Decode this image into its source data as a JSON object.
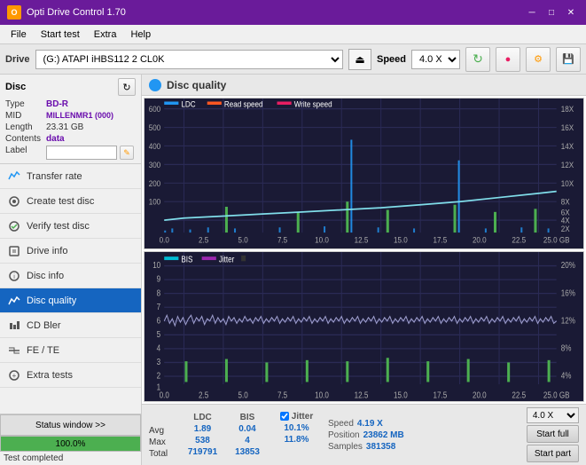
{
  "titlebar": {
    "title": "Opti Drive Control 1.70",
    "min_btn": "─",
    "max_btn": "□",
    "close_btn": "✕"
  },
  "menubar": {
    "items": [
      "File",
      "Start test",
      "Extra",
      "Help"
    ]
  },
  "drivebar": {
    "drive_label": "Drive",
    "drive_value": "(G:) ATAPI iHBS112  2 CL0K",
    "speed_label": "Speed",
    "speed_value": "4.0 X"
  },
  "disc_panel": {
    "title": "Disc",
    "type_label": "Type",
    "type_value": "BD-R",
    "mid_label": "MID",
    "mid_value": "MILLENMR1 (000)",
    "length_label": "Length",
    "length_value": "23.31 GB",
    "contents_label": "Contents",
    "contents_value": "data",
    "label_label": "Label"
  },
  "nav_items": [
    {
      "id": "transfer-rate",
      "label": "Transfer rate",
      "active": false
    },
    {
      "id": "create-test-disc",
      "label": "Create test disc",
      "active": false
    },
    {
      "id": "verify-test-disc",
      "label": "Verify test disc",
      "active": false
    },
    {
      "id": "drive-info",
      "label": "Drive info",
      "active": false
    },
    {
      "id": "disc-info",
      "label": "Disc info",
      "active": false
    },
    {
      "id": "disc-quality",
      "label": "Disc quality",
      "active": true
    },
    {
      "id": "cd-bler",
      "label": "CD Bler",
      "active": false
    },
    {
      "id": "fe-te",
      "label": "FE / TE",
      "active": false
    },
    {
      "id": "extra-tests",
      "label": "Extra tests",
      "active": false
    }
  ],
  "status_bar": {
    "window_btn": "Status window >>",
    "progress": 100.0,
    "progress_text": "100.0%",
    "status_text": "Test completed"
  },
  "content": {
    "title": "Disc quality"
  },
  "chart1": {
    "legend": [
      {
        "label": "LDC",
        "color": "#2196f3"
      },
      {
        "label": "Read speed",
        "color": "#ff5722"
      },
      {
        "label": "Write speed",
        "color": "#e91e63"
      }
    ],
    "y_labels_right": [
      "18X",
      "16X",
      "14X",
      "12X",
      "10X",
      "8X",
      "6X",
      "4X",
      "2X"
    ],
    "y_labels_left": [
      "600",
      "500",
      "400",
      "300",
      "200",
      "100"
    ],
    "x_labels": [
      "0.0",
      "2.5",
      "5.0",
      "7.5",
      "10.0",
      "12.5",
      "15.0",
      "17.5",
      "20.0",
      "22.5",
      "25.0 GB"
    ]
  },
  "chart2": {
    "legend": [
      {
        "label": "BIS",
        "color": "#00bcd4"
      },
      {
        "label": "Jitter",
        "color": "#9c27b0"
      }
    ],
    "y_labels_right": [
      "20%",
      "16%",
      "12%",
      "8%",
      "4%"
    ],
    "y_labels_left": [
      "10",
      "9",
      "8",
      "7",
      "6",
      "5",
      "4",
      "3",
      "2",
      "1"
    ],
    "x_labels": [
      "0.0",
      "2.5",
      "5.0",
      "7.5",
      "10.0",
      "12.5",
      "15.0",
      "17.5",
      "20.0",
      "22.5",
      "25.0 GB"
    ]
  },
  "stats": {
    "col_headers": [
      "",
      "LDC",
      "BIS",
      "",
      "Jitter"
    ],
    "avg_label": "Avg",
    "avg_ldc": "1.89",
    "avg_bis": "0.04",
    "avg_jitter": "10.1%",
    "max_label": "Max",
    "max_ldc": "538",
    "max_bis": "4",
    "max_jitter": "11.8%",
    "total_label": "Total",
    "total_ldc": "719791",
    "total_bis": "13853",
    "speed_label": "Speed",
    "speed_value": "4.19 X",
    "position_label": "Position",
    "position_value": "23862 MB",
    "samples_label": "Samples",
    "samples_value": "381358",
    "speed_dropdown": "4.0 X",
    "start_full_btn": "Start full",
    "start_part_btn": "Start part"
  }
}
